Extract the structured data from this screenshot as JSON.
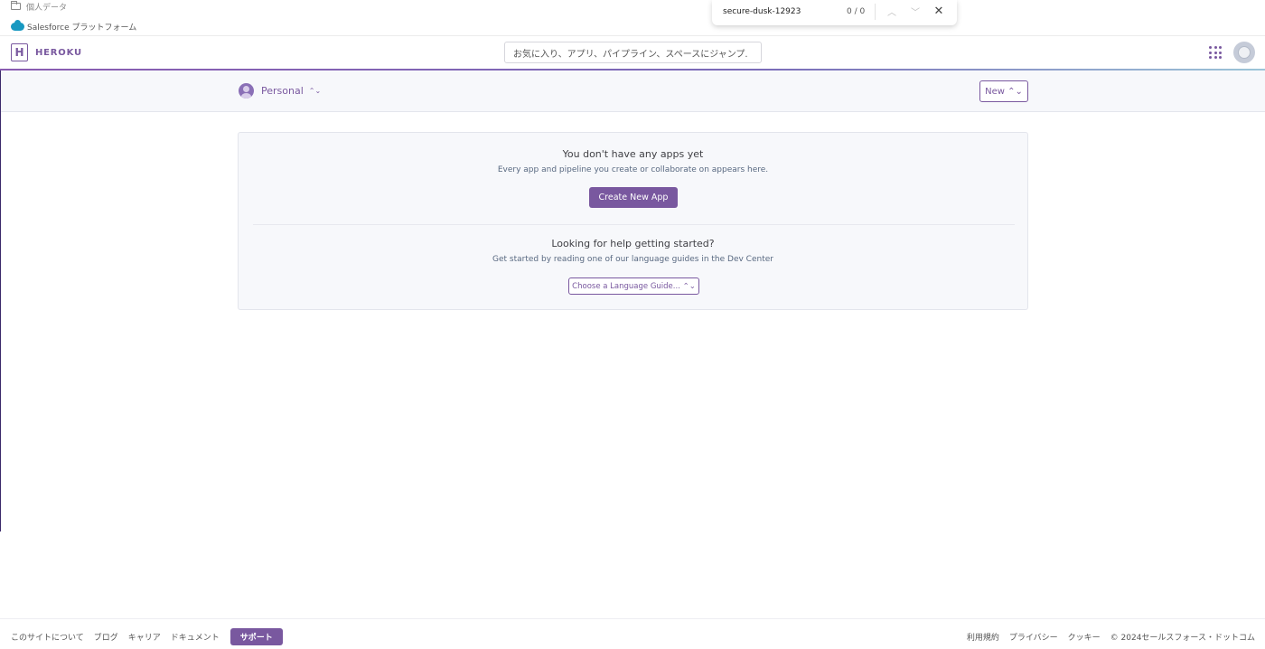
{
  "bookmarks": {
    "folder_label": "個人データ",
    "salesforce_label": "Salesforce プラットフォーム"
  },
  "find_bar": {
    "query": "secure-dusk-12923",
    "count": "0 / 0",
    "up_glyph": "︿",
    "down_glyph": "﹀",
    "close_glyph": "✕"
  },
  "header": {
    "logo_mark": "H",
    "logo_text": "HEROKU",
    "search_placeholder": "お気に入り、アプリ、パイプライン、スペースにジャンプ.",
    "accent_color": "#79589f"
  },
  "subheader": {
    "account_label": "Personal",
    "caret": "⌃⌄",
    "new_button": "New ⌃⌄"
  },
  "empty_state": {
    "title": "You don't have any apps yet",
    "subtitle": "Every app and pipeline you create or collaborate on appears here.",
    "create_button": "Create New App",
    "help_title": "Looking for help getting started?",
    "help_subtitle": "Get started by reading one of our language guides in the Dev Center",
    "language_select": "Choose a Language Guide... ⌃⌄"
  },
  "footer": {
    "left_links": [
      "このサイトについて",
      "ブログ",
      "キャリア",
      "ドキュメント"
    ],
    "support_button": "サポート",
    "right_links": [
      "利用規約",
      "プライバシー",
      "クッキー",
      "© 2024セールスフォース・ドットコム"
    ]
  }
}
